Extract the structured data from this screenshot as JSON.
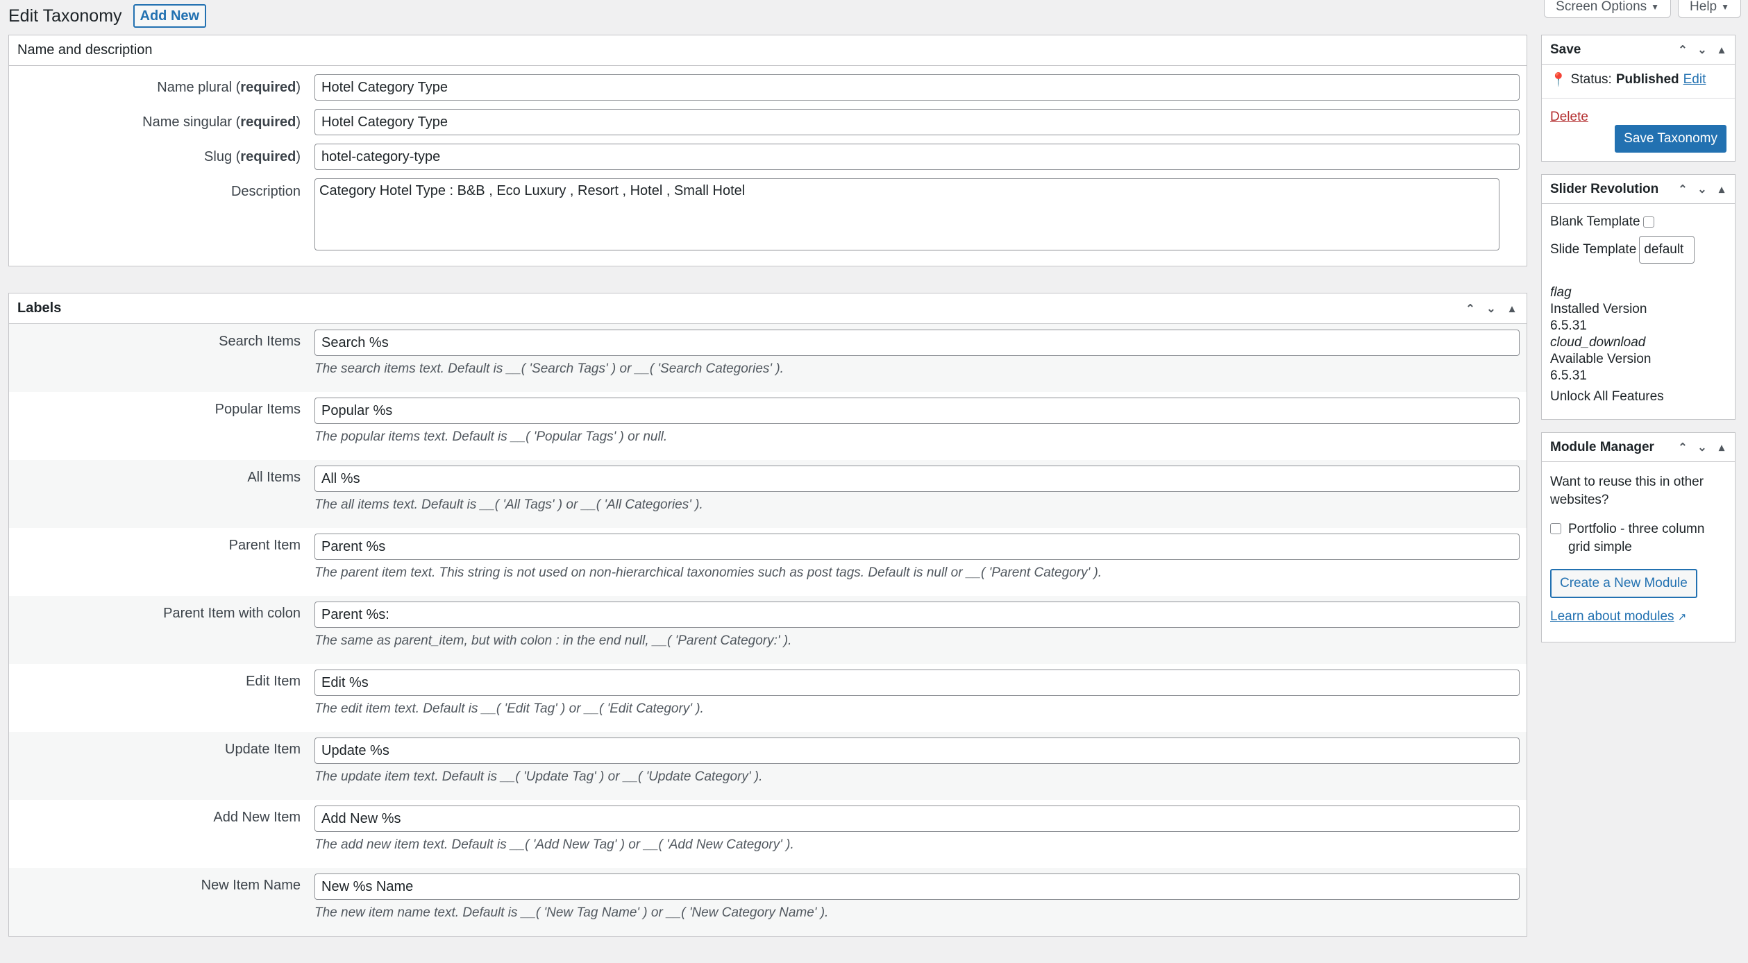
{
  "header": {
    "title": "Edit Taxonomy",
    "add_new": "Add New",
    "screen_options": "Screen Options",
    "help": "Help"
  },
  "name_panel": {
    "title": "Name and description",
    "required": "required",
    "plural": {
      "label": "Name plural",
      "value": "Hotel Category Type"
    },
    "singular": {
      "label": "Name singular",
      "value": "Hotel Category Type"
    },
    "slug": {
      "label": "Slug",
      "value": "hotel-category-type"
    },
    "description": {
      "label": "Description",
      "value": "Category Hotel Type : B&B , Eco Luxury , Resort , Hotel , Small Hotel"
    }
  },
  "labels_panel": {
    "title": "Labels",
    "rows": [
      {
        "label": "Search Items",
        "value": "Search %s",
        "hint": "The search items text. Default is __( 'Search Tags' ) or __( 'Search Categories' )."
      },
      {
        "label": "Popular Items",
        "value": "Popular %s",
        "hint": "The popular items text. Default is __( 'Popular Tags' ) or null."
      },
      {
        "label": "All Items",
        "value": "All %s",
        "hint": "The all items text. Default is __( 'All Tags' ) or __( 'All Categories' )."
      },
      {
        "label": "Parent Item",
        "value": "Parent %s",
        "hint": "The parent item text. This string is not used on non-hierarchical taxonomies such as post tags. Default is null or __( 'Parent Category' )."
      },
      {
        "label": "Parent Item with colon",
        "value": "Parent %s:",
        "hint": "The same as parent_item, but with colon : in the end null, __( 'Parent Category:' )."
      },
      {
        "label": "Edit Item",
        "value": "Edit %s",
        "hint": "The edit item text. Default is __( 'Edit Tag' ) or __( 'Edit Category' )."
      },
      {
        "label": "Update Item",
        "value": "Update %s",
        "hint": "The update item text. Default is __( 'Update Tag' ) or __( 'Update Category' )."
      },
      {
        "label": "Add New Item",
        "value": "Add New %s",
        "hint": "The add new item text. Default is __( 'Add New Tag' ) or __( 'Add New Category' )."
      },
      {
        "label": "New Item Name",
        "value": "New %s Name",
        "hint": "The new item name text. Default is __( 'New Tag Name' ) or __( 'New Category Name' )."
      }
    ]
  },
  "save_box": {
    "title": "Save",
    "status_label": "Status:",
    "status_value": "Published",
    "edit": "Edit",
    "delete": "Delete",
    "save": "Save Taxonomy"
  },
  "slider_box": {
    "title": "Slider Revolution",
    "blank_template": "Blank Template",
    "slide_template": "Slide Template",
    "slide_template_value": "default",
    "flag": "flag",
    "installed_label": "Installed Version",
    "installed_version": "6.5.31",
    "cloud": "cloud_download",
    "available_label": "Available Version",
    "available_version": "6.5.31",
    "unlock": "Unlock All Features"
  },
  "module_box": {
    "title": "Module Manager",
    "text": "Want to reuse this in other websites?",
    "module_option": "Portfolio - three column grid simple",
    "create": "Create a New Module",
    "learn": "Learn about modules"
  }
}
